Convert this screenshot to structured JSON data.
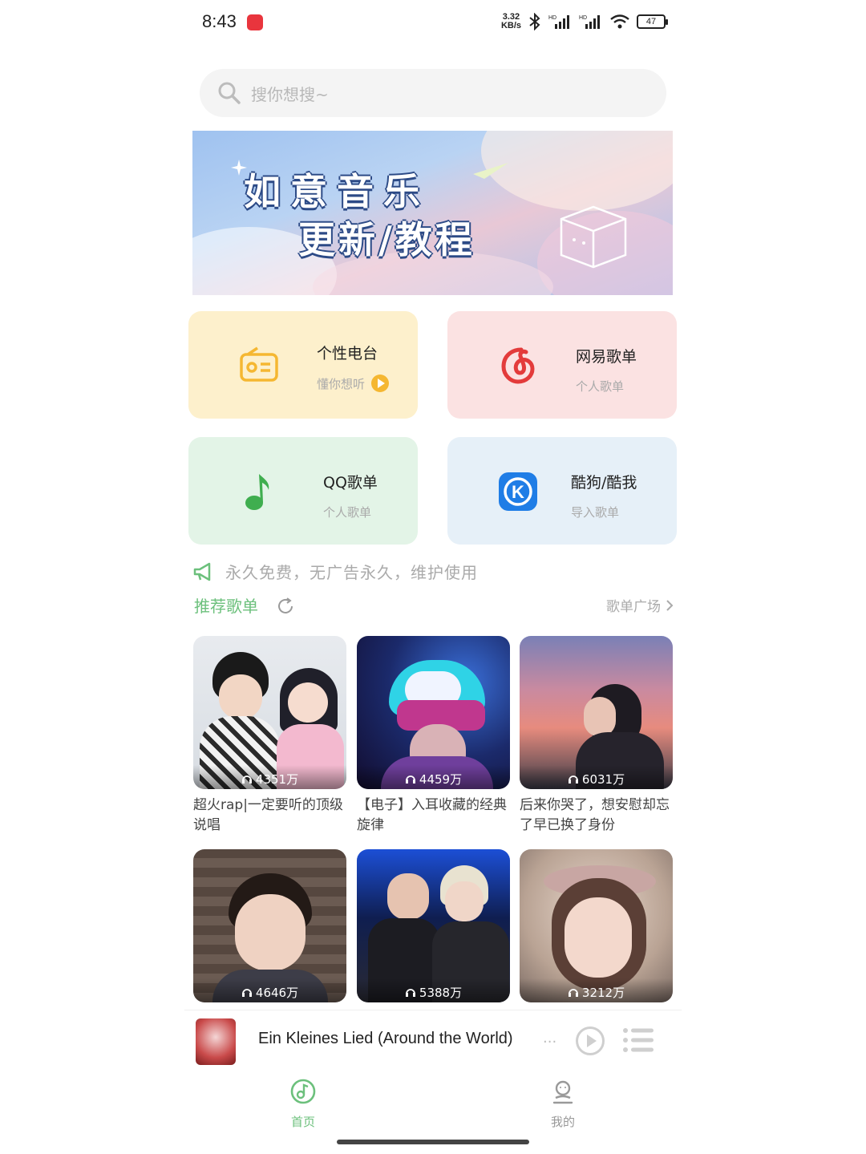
{
  "status_bar": {
    "time": "8:43",
    "net_speed_value": "3.32",
    "net_speed_unit": "KB/s",
    "battery": "47"
  },
  "search": {
    "placeholder": "搜你想搜~"
  },
  "banner": {
    "line1": "如意音乐",
    "line2": "更新/教程"
  },
  "shortcuts": [
    {
      "title": "个性电台",
      "subtitle": "懂你想听",
      "icon": "radio-icon",
      "color": "#f5b731"
    },
    {
      "title": "网易歌单",
      "subtitle": "个人歌单",
      "icon": "netease-music-icon",
      "color": "#e33b3b"
    },
    {
      "title": "QQ歌单",
      "subtitle": "个人歌单",
      "icon": "qq-music-note-icon",
      "color": "#3fae4f"
    },
    {
      "title": "酷狗/酷我",
      "subtitle": "导入歌单",
      "icon": "kugou-icon",
      "color": "#1f7de6"
    }
  ],
  "notice": {
    "text": "永久免费，无广告永久，维护使用",
    "icon": "megaphone-icon"
  },
  "recommend": {
    "title": "推荐歌单",
    "plaza_link": "歌单广场",
    "accent": "#6cc07c",
    "playlists": [
      {
        "count": "4351万",
        "title": "超火rap|一定要听的顶级说唱"
      },
      {
        "count": "4459万",
        "title": "【电子】入耳收藏的经典旋律"
      },
      {
        "count": "6031万",
        "title": "后来你哭了，想安慰却忘了早已换了身份"
      },
      {
        "count": "4646万",
        "title": ""
      },
      {
        "count": "5388万",
        "title": ""
      },
      {
        "count": "3212万",
        "title": ""
      }
    ]
  },
  "player": {
    "song_title": "Ein Kleines Lied (Around the World)",
    "ellipsis": "..."
  },
  "tabs": {
    "home": "首页",
    "mine": "我的"
  }
}
